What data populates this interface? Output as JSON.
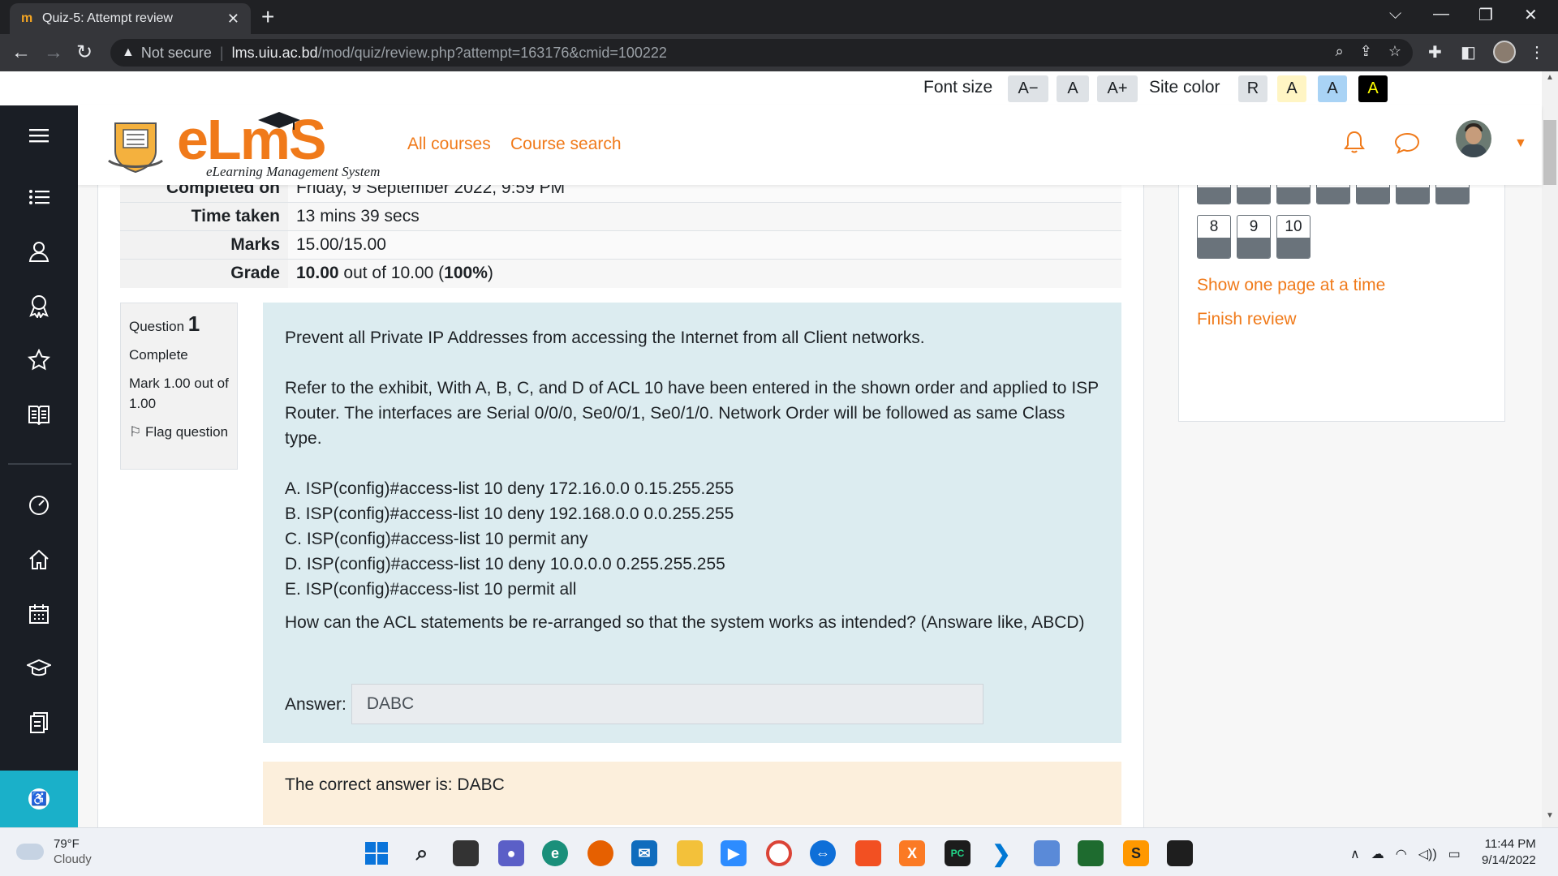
{
  "browser": {
    "tab_title": "Quiz-5: Attempt review",
    "tab_close": "✕",
    "new_tab": "+",
    "security_label": "Not secure",
    "url_host": "lms.uiu.ac.bd",
    "url_path": "/mod/quiz/review.php?attempt=163176&cmid=100222"
  },
  "accessibility_bar": {
    "font_size_label": "Font size",
    "font_buttons": [
      "A−",
      "A",
      "A+"
    ],
    "site_color_label": "Site color",
    "color_buttons": [
      {
        "label": "R",
        "bg": "#dee2e6",
        "fg": "#1d2125"
      },
      {
        "label": "A",
        "bg": "#fff5c4",
        "fg": "#1d2125"
      },
      {
        "label": "A",
        "bg": "#a9d3f5",
        "fg": "#1d2125"
      },
      {
        "label": "A",
        "bg": "#000000",
        "fg": "#ffff00"
      }
    ]
  },
  "header": {
    "logo_text": "eLmS",
    "logo_subtitle": "eLearning Management System",
    "nav": [
      "All courses",
      "Course search"
    ]
  },
  "summary": [
    {
      "label": "Completed on",
      "value": "Friday, 9 September 2022, 9:59 PM"
    },
    {
      "label": "Time taken",
      "value": "13 mins 39 secs"
    },
    {
      "label": "Marks",
      "value": "15.00/15.00"
    },
    {
      "label": "Grade",
      "value_bold": "10.00",
      "value_mid": " out of 10.00 (",
      "value_pct": "100%",
      "value_end": ")"
    }
  ],
  "question_info": {
    "label": "Question",
    "number": "1",
    "state": "Complete",
    "mark": "Mark 1.00 out of 1.00",
    "flag": "Flag question"
  },
  "question": {
    "intro": "Prevent all Private IP Addresses from accessing the Internet from all Client networks.",
    "exhibit": "Refer to the exhibit, With A, B, C, and D of ACL 10 have been entered in the shown order and applied to ISP Router. The interfaces are Serial 0/0/0, Se0/0/1, Se0/1/0. Network Order will be followed as same Class type.",
    "options": [
      "A. ISP(config)#access-list 10 deny 172.16.0.0 0.15.255.255",
      "B. ISP(config)#access-list 10 deny 192.168.0.0 0.0.255.255",
      "C. ISP(config)#access-list 10 permit any",
      "D. ISP(config)#access-list 10 deny 10.0.0.0 0.255.255.255",
      "E. ISP(config)#access-list 10 permit all"
    ],
    "prompt": "How can the ACL statements be re-arranged so that the system works as intended? (Answare like, ABCD)",
    "answer_label": "Answer:",
    "answer_value": "DABC"
  },
  "feedback": {
    "text": "The correct answer is: DABC"
  },
  "quiz_navigation": {
    "visible_numbers": [
      "8",
      "9",
      "10"
    ],
    "links": [
      "Show one page at a time",
      "Finish review"
    ]
  },
  "taskbar": {
    "weather_temp": "79°F",
    "weather_desc": "Cloudy",
    "time": "11:44 PM",
    "date": "9/14/2022"
  },
  "colors": {
    "accent": "#f07a1a",
    "sidebar": "#1a1e25",
    "question_bg": "#dcecf0",
    "feedback_bg": "#fcefdc",
    "a11y_button": "#1ab0c9"
  }
}
